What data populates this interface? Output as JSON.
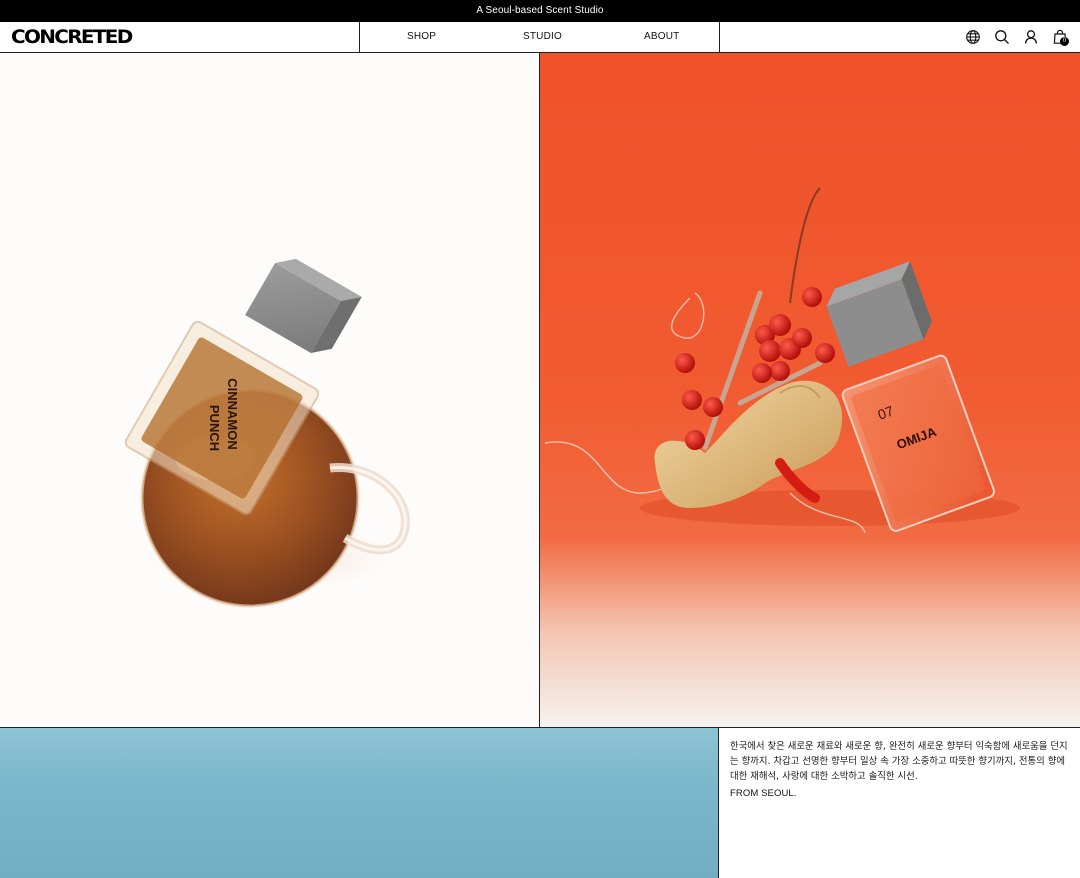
{
  "announcement": "A Seoul-based Scent Studio",
  "brand": "CONCRETED",
  "nav": {
    "shop": "SHOP",
    "studio": "STUDIO",
    "about": "ABOUT"
  },
  "header_icons": [
    "globe-icon",
    "search-icon",
    "account-icon",
    "shopping-bag-icon"
  ],
  "cart_count": "0",
  "products": {
    "left_label_line1": "CINNAMON",
    "left_label_line2": "PUNCH",
    "right_number": "07",
    "right_label": "OMIJA"
  },
  "intro": {
    "text": "한국에서 찾은 새로운 재료와 새로운 향, 완전히 새로운 향부터 익숙함에 새로움을 던지는 향까지. 차갑고 선명한 향부터 일상 속 가장 소중하고 따뜻한 향기까지, 전통의 향에 대한 재해석, 사랑에 대한 소박하고 솔직한 시선.",
    "tagline": "FROM SEOUL."
  },
  "colors": {
    "announcement_bg": "#000000",
    "hero_right_bg": "#f0522a",
    "hero_blue_bg": "#7cb6ca",
    "border": "#222222"
  }
}
